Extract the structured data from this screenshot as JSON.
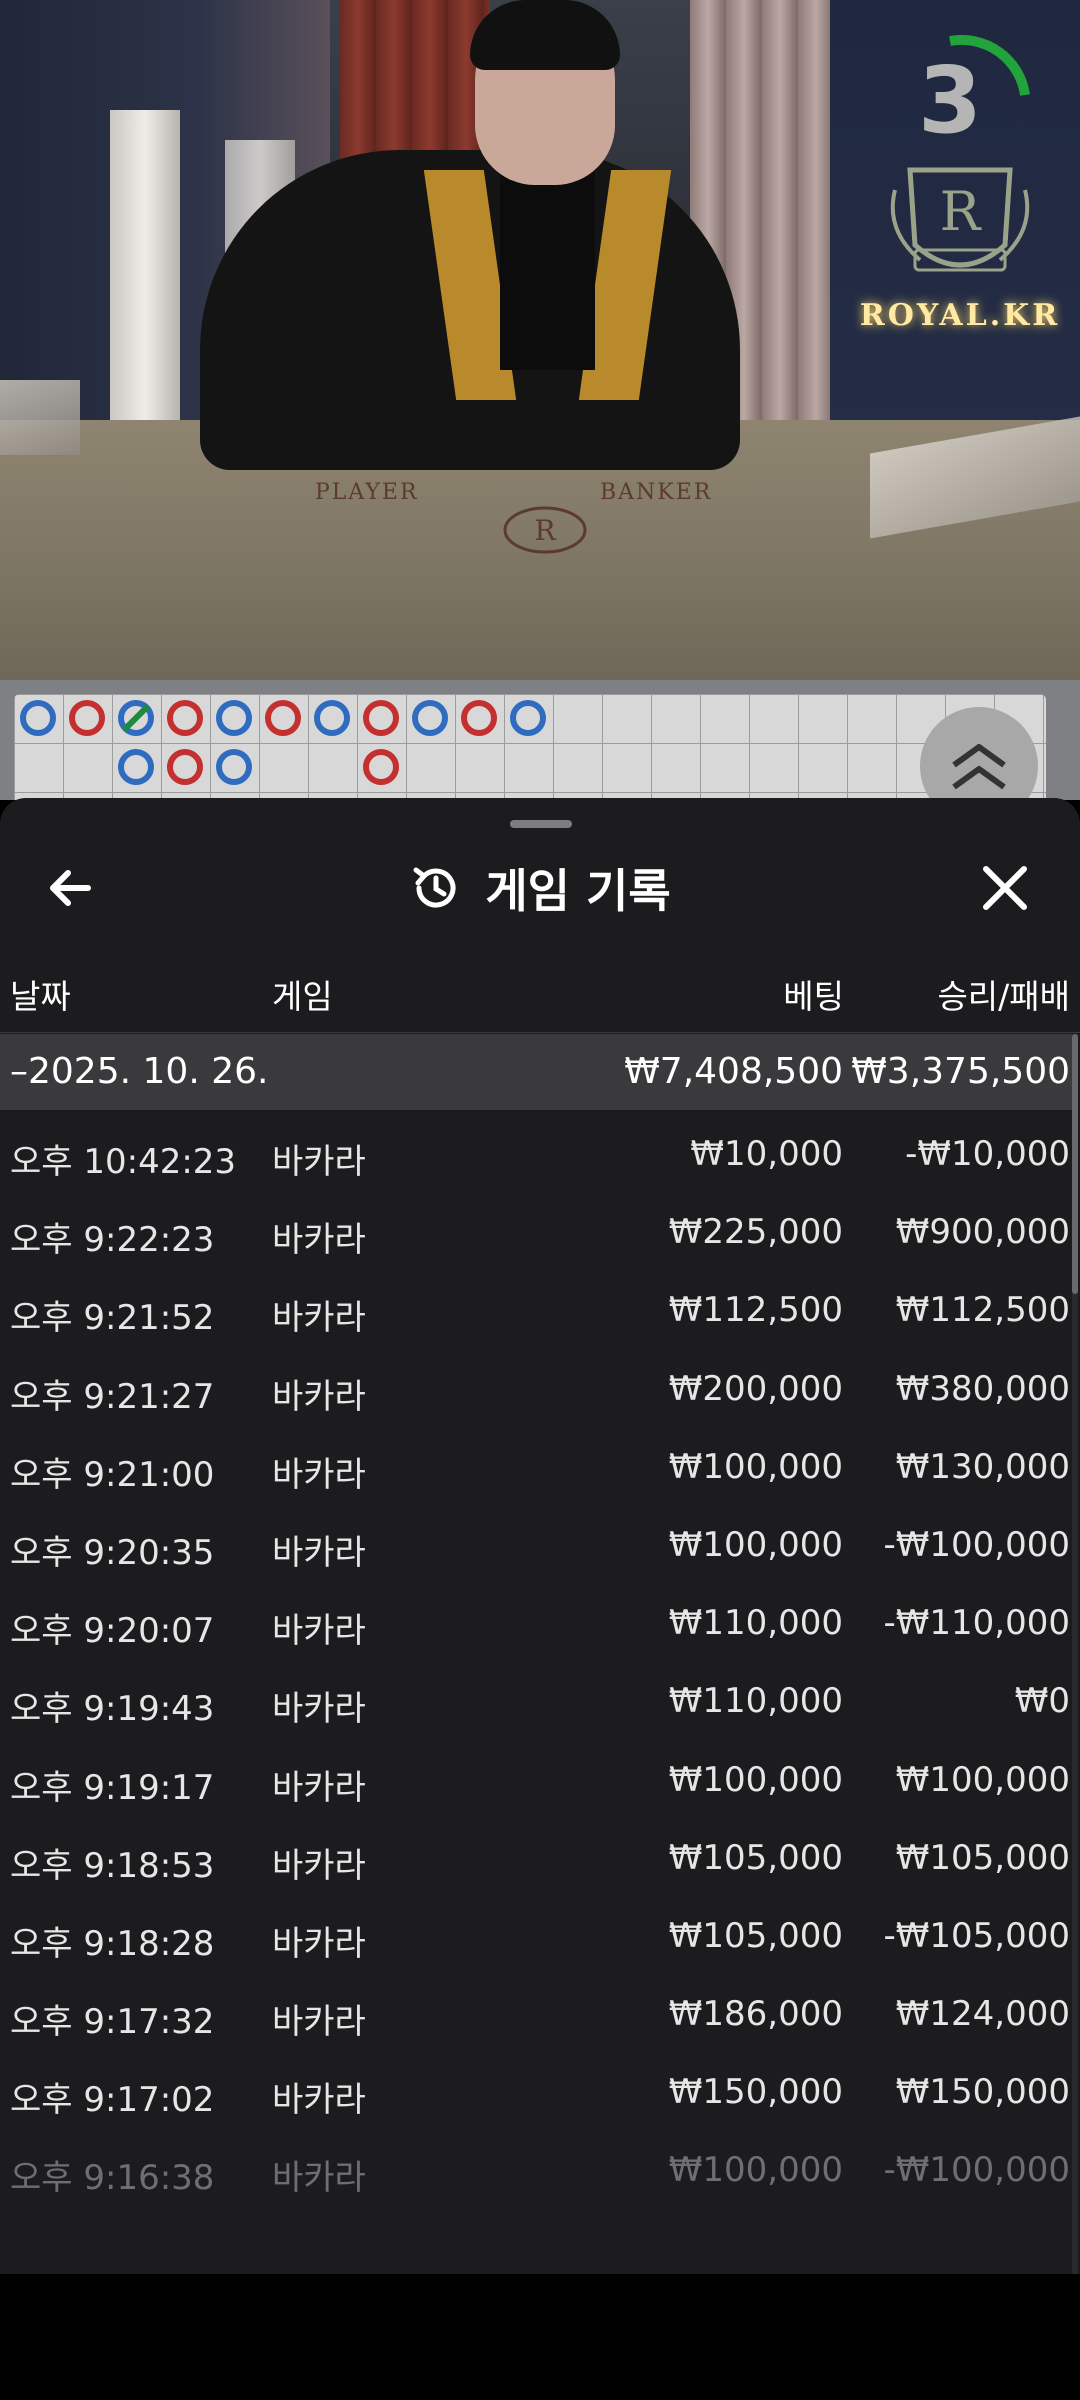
{
  "video": {
    "countdown": "3",
    "brand": "ROYAL.KR",
    "table_label_player": "PLAYER",
    "table_label_banker": "BANKER"
  },
  "road": {
    "beads": [
      {
        "col": 0,
        "row": 0,
        "side": "B"
      },
      {
        "col": 1,
        "row": 0,
        "side": "P"
      },
      {
        "col": 2,
        "row": 0,
        "side": "B",
        "tie": true
      },
      {
        "col": 3,
        "row": 0,
        "side": "P"
      },
      {
        "col": 4,
        "row": 0,
        "side": "B"
      },
      {
        "col": 5,
        "row": 0,
        "side": "P"
      },
      {
        "col": 6,
        "row": 0,
        "side": "B"
      },
      {
        "col": 7,
        "row": 0,
        "side": "P"
      },
      {
        "col": 8,
        "row": 0,
        "side": "B"
      },
      {
        "col": 9,
        "row": 0,
        "side": "P"
      },
      {
        "col": 10,
        "row": 0,
        "side": "B"
      },
      {
        "col": 2,
        "row": 1,
        "side": "B"
      },
      {
        "col": 3,
        "row": 1,
        "side": "P"
      },
      {
        "col": 4,
        "row": 1,
        "side": "B"
      },
      {
        "col": 7,
        "row": 1,
        "side": "P"
      }
    ],
    "colors": {
      "banker": "#2f6cc0",
      "player": "#c42f2f",
      "tie": "#1e8a3c"
    }
  },
  "header": {
    "title": "게임 기록",
    "back_icon": "arrow-left-icon",
    "history_icon": "history-icon",
    "close_icon": "close-icon"
  },
  "columns": {
    "date": "날짜",
    "game": "게임",
    "bet": "베팅",
    "result": "승리/패배"
  },
  "summary": {
    "date": "–2025. 10. 26.",
    "bet_total": "₩7,408,500",
    "result_total": "₩3,375,500"
  },
  "rows": [
    {
      "time": "오후 10:42:23",
      "game": "바카라",
      "bet": "₩10,000",
      "result": "-₩10,000"
    },
    {
      "time": "오후 9:22:23",
      "game": "바카라",
      "bet": "₩225,000",
      "result": "₩900,000"
    },
    {
      "time": "오후 9:21:52",
      "game": "바카라",
      "bet": "₩112,500",
      "result": "₩112,500"
    },
    {
      "time": "오후 9:21:27",
      "game": "바카라",
      "bet": "₩200,000",
      "result": "₩380,000"
    },
    {
      "time": "오후 9:21:00",
      "game": "바카라",
      "bet": "₩100,000",
      "result": "₩130,000"
    },
    {
      "time": "오후 9:20:35",
      "game": "바카라",
      "bet": "₩100,000",
      "result": "-₩100,000"
    },
    {
      "time": "오후 9:20:07",
      "game": "바카라",
      "bet": "₩110,000",
      "result": "-₩110,000"
    },
    {
      "time": "오후 9:19:43",
      "game": "바카라",
      "bet": "₩110,000",
      "result": "₩0"
    },
    {
      "time": "오후 9:19:17",
      "game": "바카라",
      "bet": "₩100,000",
      "result": "₩100,000"
    },
    {
      "time": "오후 9:18:53",
      "game": "바카라",
      "bet": "₩105,000",
      "result": "₩105,000"
    },
    {
      "time": "오후 9:18:28",
      "game": "바카라",
      "bet": "₩105,000",
      "result": "-₩105,000"
    },
    {
      "time": "오후 9:17:32",
      "game": "바카라",
      "bet": "₩186,000",
      "result": "₩124,000"
    },
    {
      "time": "오후 9:17:02",
      "game": "바카라",
      "bet": "₩150,000",
      "result": "₩150,000"
    },
    {
      "time": "오후 9:16:38",
      "game": "바카라",
      "bet": "₩100,000",
      "result": "-₩100,000"
    }
  ]
}
